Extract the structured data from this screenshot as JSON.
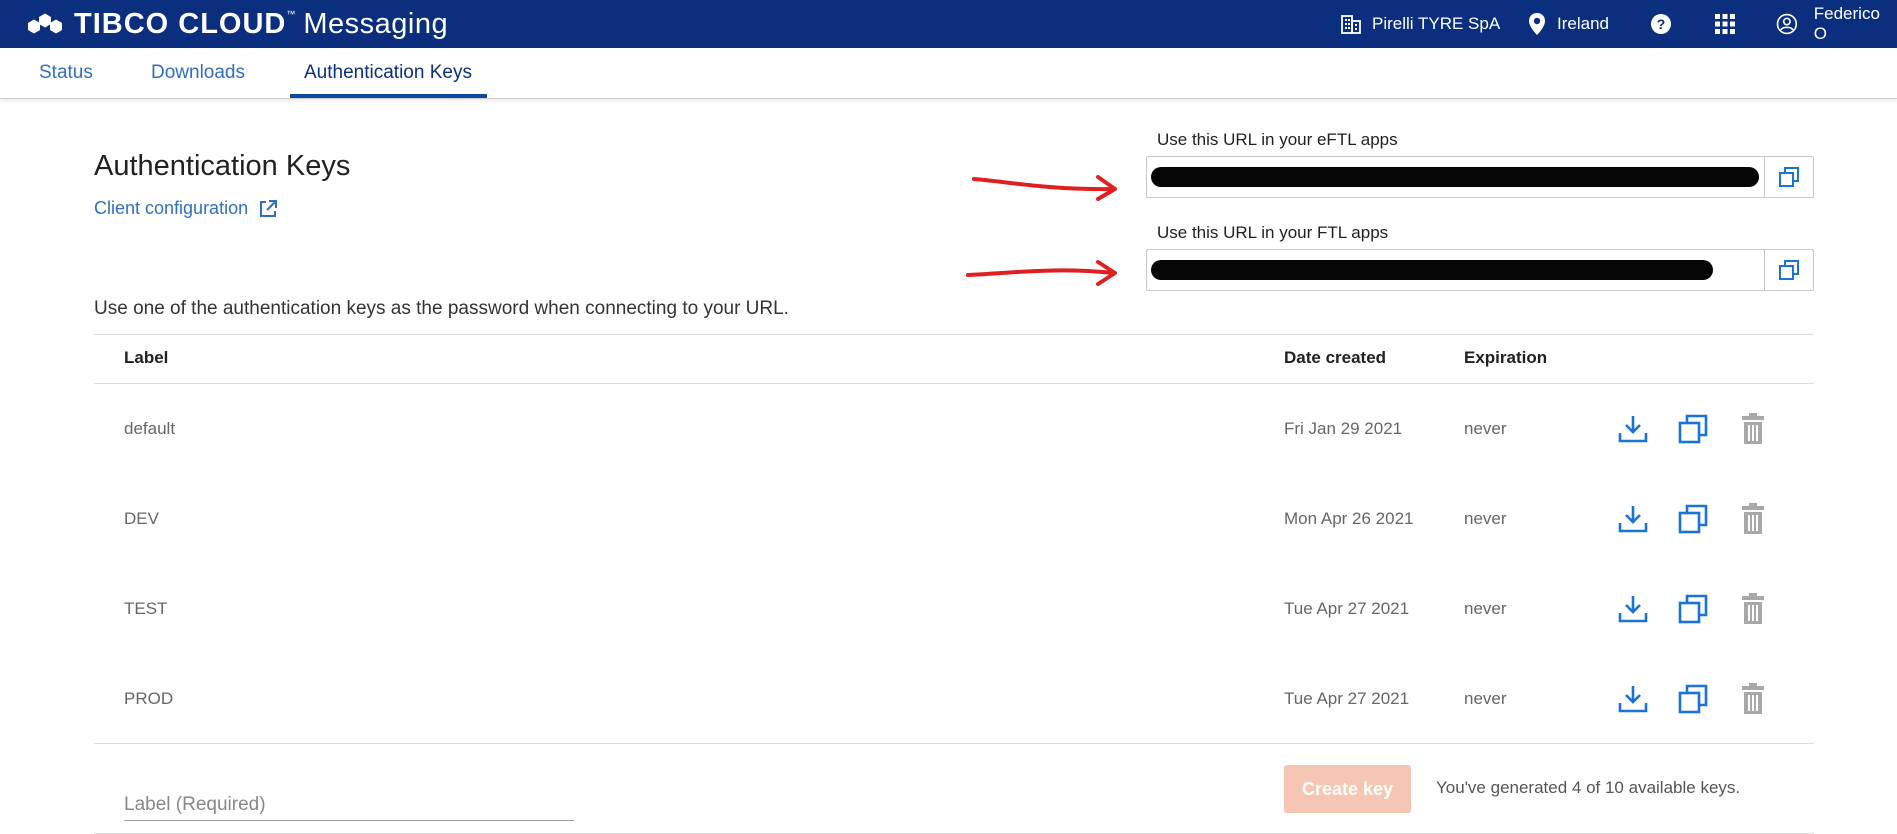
{
  "topbar": {
    "brand_strong": "TIBCO CLOUD",
    "brand_tm": "™",
    "brand_light": "Messaging",
    "org": "Pirelli TYRE SpA",
    "region": "Ireland",
    "user": "Federico O"
  },
  "tabs": [
    {
      "label": "Status"
    },
    {
      "label": "Downloads"
    },
    {
      "label": "Authentication Keys",
      "active": true
    }
  ],
  "page": {
    "title": "Authentication Keys",
    "client_config": "Client configuration",
    "intro": "Use one of the authentication keys as the password when connecting to your URL."
  },
  "urls": {
    "eftl_label": "Use this URL in your eFTL apps",
    "ftl_label": "Use this URL in your FTL apps"
  },
  "table": {
    "headers": {
      "label": "Label",
      "date": "Date created",
      "expiration": "Expiration"
    },
    "rows": [
      {
        "label": "default",
        "date": "Fri Jan 29 2021",
        "expiration": "never"
      },
      {
        "label": "DEV",
        "date": "Mon Apr 26 2021",
        "expiration": "never"
      },
      {
        "label": "TEST",
        "date": "Tue Apr 27 2021",
        "expiration": "never"
      },
      {
        "label": "PROD",
        "date": "Tue Apr 27 2021",
        "expiration": "never"
      }
    ]
  },
  "form": {
    "label_placeholder": "Label (Required)",
    "create_button": "Create key",
    "key_count": "You've generated 4 of 10 available keys."
  },
  "colors": {
    "topbar": "#0b2f7e",
    "link": "#2f6fc0",
    "action_icon": "#1a73d6",
    "delete_icon": "#a8a8a8",
    "create_button_disabled": "#f6c6b4",
    "annotation_arrow": "#e02020"
  },
  "icons": {
    "org": "building-icon",
    "region": "location-pin-icon",
    "help": "help-icon",
    "apps": "apps-grid-icon",
    "user": "user-icon",
    "external": "external-link-icon",
    "copy": "copy-icon",
    "download": "download-icon",
    "delete": "trash-icon"
  }
}
